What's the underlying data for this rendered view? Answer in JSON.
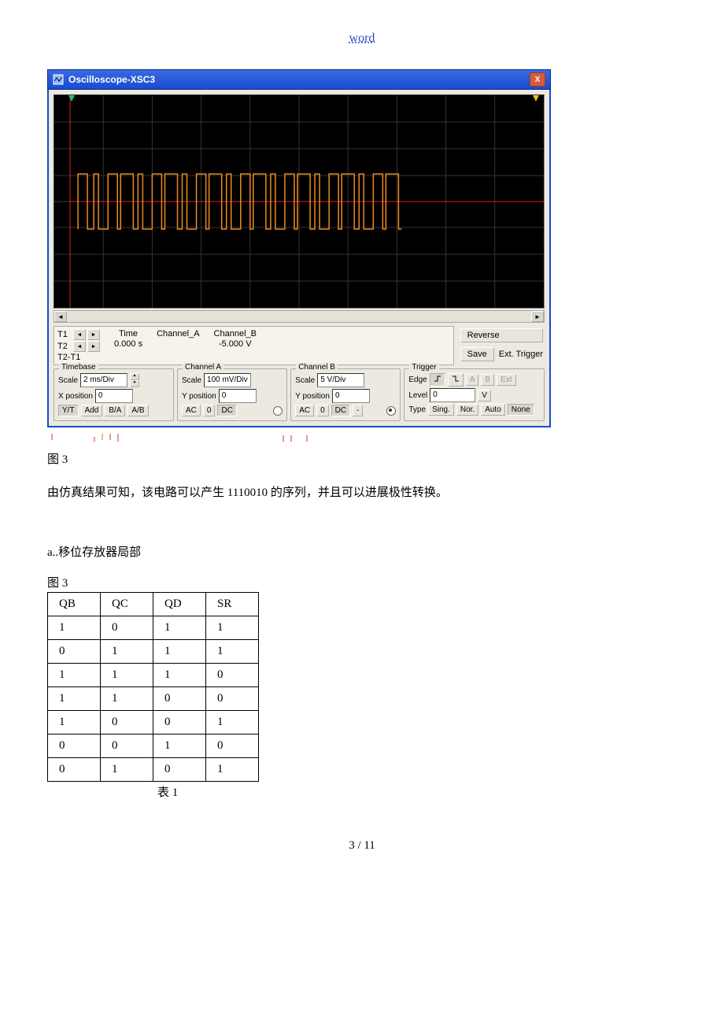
{
  "header_link": "word",
  "osc": {
    "title": "Oscilloscope-XSC3",
    "close": "X",
    "cursor": {
      "t1": "T1",
      "t2": "T2",
      "t2t1": "T2-T1",
      "time_label": "Time",
      "time_val": "0.000 s",
      "chA_label": "Channel_A",
      "chA_val": "",
      "chB_label": "Channel_B",
      "chB_val": "-5.000 V",
      "reverse": "Reverse",
      "save": "Save",
      "ext_trigger": "Ext. Trigger"
    },
    "timebase": {
      "legend": "Timebase",
      "scale_label": "Scale",
      "scale_val": "2 ms/Div",
      "xpos_label": "X position",
      "xpos_val": "0",
      "btns": {
        "yt": "Y/T",
        "add": "Add",
        "ba": "B/A",
        "ab": "A/B"
      }
    },
    "chA": {
      "legend": "Channel A",
      "scale_label": "Scale",
      "scale_val": "100 mV/Div",
      "ypos_label": "Y position",
      "ypos_val": "0",
      "btns": {
        "ac": "AC",
        "zero": "0",
        "dc": "DC"
      }
    },
    "chB": {
      "legend": "Channel B",
      "scale_label": "Scale",
      "scale_val": "5  V/Div",
      "ypos_label": "Y position",
      "ypos_val": "0",
      "btns": {
        "ac": "AC",
        "zero": "0",
        "dc": "DC",
        "minus": "-"
      }
    },
    "trigger": {
      "legend": "Trigger",
      "edge_label": "Edge",
      "edge_btns": {
        "rise": "↱",
        "fall": "↳",
        "a": "A",
        "b": "B",
        "ext": "Ext"
      },
      "level_label": "Level",
      "level_val": "0",
      "level_unit": "V",
      "type_label": "Type",
      "type_btns": {
        "sing": "Sing.",
        "nor": "Nor.",
        "auto": "Auto",
        "none": "None"
      }
    }
  },
  "fig_caption_top": "图 3",
  "paragraph": "由仿真结果可知，该电路可以产生 1110010 的序列，并且可以进展极性转换。",
  "subhead": "a..移位存放器局部",
  "fig_caption_mid": "图 3",
  "table": {
    "headers": [
      "QB",
      "QC",
      "QD",
      "SR"
    ],
    "rows": [
      [
        "1",
        "0",
        "1",
        "1"
      ],
      [
        "0",
        "1",
        "1",
        "1"
      ],
      [
        "1",
        "1",
        "1",
        "0"
      ],
      [
        "1",
        "1",
        "0",
        "0"
      ],
      [
        "1",
        "0",
        "0",
        "1"
      ],
      [
        "0",
        "0",
        "1",
        "0"
      ],
      [
        "0",
        "1",
        "0",
        "1"
      ]
    ]
  },
  "table_label": "表 1",
  "page_num": "3 / 11"
}
